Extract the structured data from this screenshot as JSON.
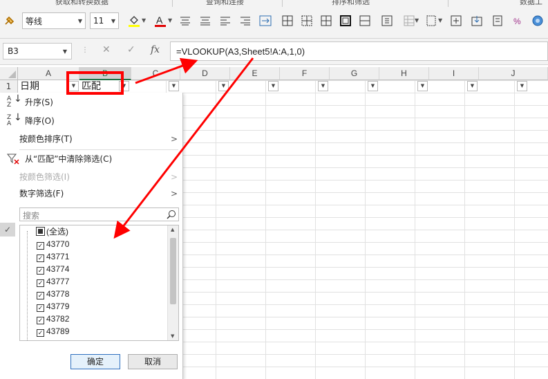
{
  "ribbon": {
    "group_labels": [
      "获取和转换数据",
      "查询和连接",
      "排序和筛选",
      "数据工"
    ],
    "font_name": "等线",
    "font_size": "11"
  },
  "formula_bar": {
    "name_box": "B3",
    "cancel_icon": "✕",
    "enter_icon": "✓",
    "fx_label": "fx",
    "formula": "=VLOOKUP(A3,Sheet5!A:A,1,0)"
  },
  "sheet": {
    "columns": [
      "A",
      "B",
      "C",
      "D",
      "E",
      "F",
      "G",
      "H",
      "I",
      "J"
    ],
    "row_number": "1",
    "cells": {
      "A1": "日期",
      "B1": "匹配"
    }
  },
  "filter_menu": {
    "sort_asc": "升序(S)",
    "sort_desc": "降序(O)",
    "sort_by_color": "按颜色排序(T)",
    "clear_filter": "从“匹配”中清除筛选(C)",
    "filter_by_color": "按颜色筛选(I)",
    "number_filters": "数字筛选(F)",
    "search_placeholder": "搜索",
    "select_all": "(全选)",
    "items": [
      "43770",
      "43771",
      "43774",
      "43777",
      "43778",
      "43779",
      "43782",
      "43789"
    ],
    "ok": "确定",
    "cancel": "取消"
  },
  "colors": {
    "accent": "#217346",
    "annotation": "#ff0000"
  },
  "icons": [
    "format-painter-icon",
    "fill-color-icon",
    "font-color-icon",
    "align-left-icon",
    "align-center-icon",
    "align-right-icon",
    "wrap-icon",
    "border-icon",
    "filter-clear-icon",
    "search-icon",
    "checkmark-icon"
  ]
}
